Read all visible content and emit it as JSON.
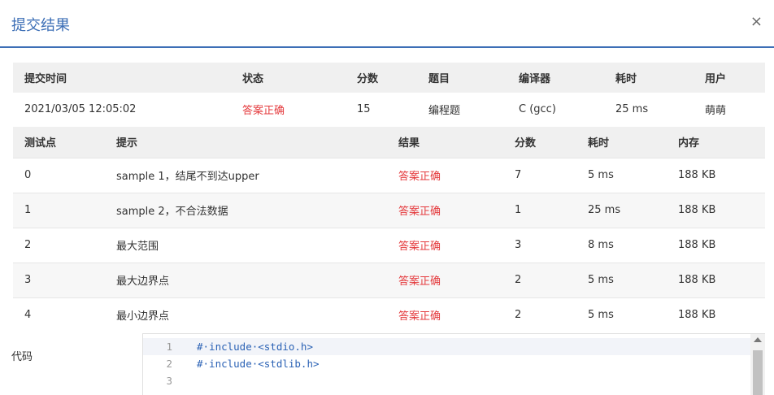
{
  "dialog": {
    "title": "提交结果",
    "close_symbol": "×"
  },
  "summary": {
    "headers": [
      "提交时间",
      "状态",
      "分数",
      "题目",
      "编译器",
      "耗时",
      "用户"
    ],
    "row": [
      "2021/03/05 12:05:02",
      "答案正确",
      "15",
      "编程题",
      "C (gcc)",
      "25 ms",
      "萌萌"
    ]
  },
  "cases": {
    "headers": [
      "测试点",
      "提示",
      "结果",
      "分数",
      "耗时",
      "内存"
    ],
    "rows": [
      [
        "0",
        "sample 1，结尾不到达upper",
        "答案正确",
        "7",
        "5 ms",
        "188 KB"
      ],
      [
        "1",
        "sample 2，不合法数据",
        "答案正确",
        "1",
        "25 ms",
        "188 KB"
      ],
      [
        "2",
        "最大范围",
        "答案正确",
        "3",
        "8 ms",
        "188 KB"
      ],
      [
        "3",
        "最大边界点",
        "答案正确",
        "2",
        "5 ms",
        "188 KB"
      ],
      [
        "4",
        "最小边界点",
        "答案正确",
        "2",
        "5 ms",
        "188 KB"
      ]
    ]
  },
  "code": {
    "label": "代码",
    "lines": [
      {
        "num": "1",
        "text": "#·include·<stdio.h>"
      },
      {
        "num": "2",
        "text": "#·include·<stdlib.h>"
      },
      {
        "num": "3",
        "text": ""
      }
    ]
  },
  "colors": {
    "accent": "#3d6fb6",
    "status_ok": "#e4393c"
  }
}
